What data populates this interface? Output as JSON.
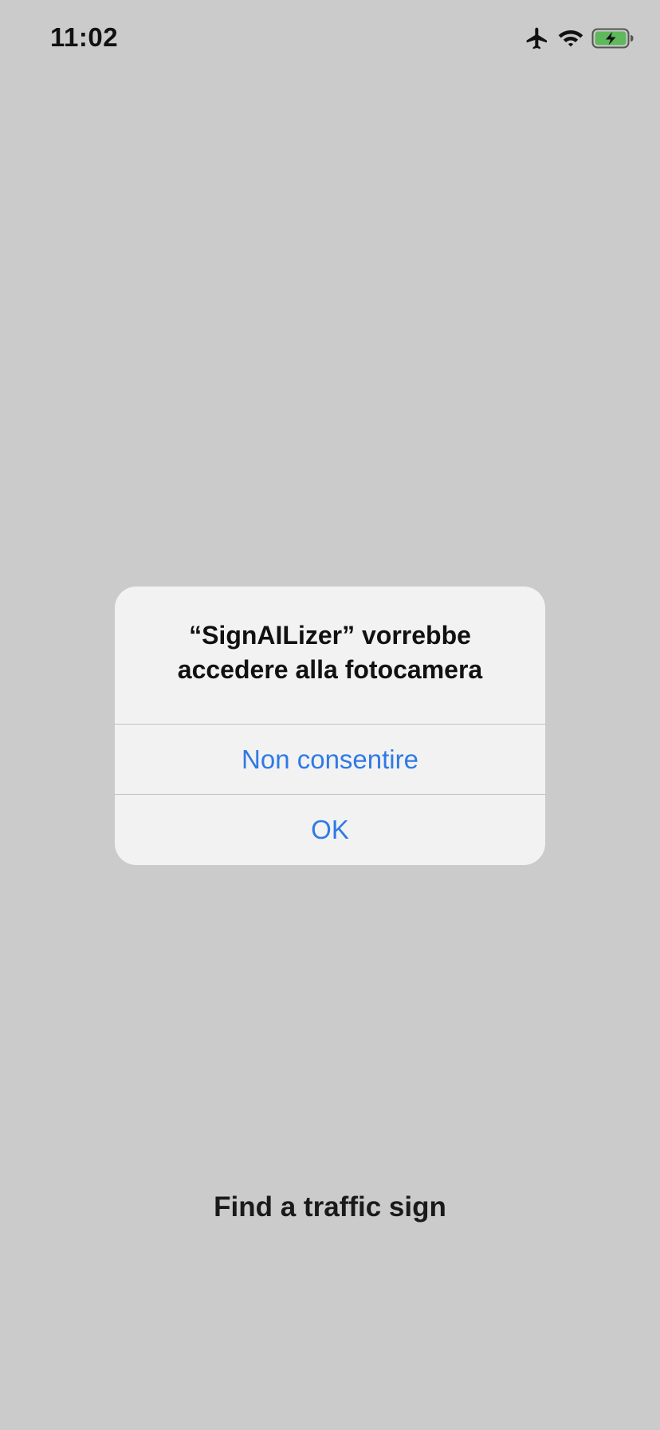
{
  "status_bar": {
    "time": "11:02",
    "icons": [
      "airplane-mode-icon",
      "wifi-icon",
      "battery-charging-icon"
    ],
    "battery_color": "#5fb85b"
  },
  "app": {
    "prompt": "Find a traffic sign",
    "background_color": "#cbcbcb"
  },
  "alert": {
    "title": "“SignAILizer” vorrebbe accedere alla fotocamera",
    "buttons": {
      "deny_label": "Non consentire",
      "ok_label": "OK"
    },
    "button_color": "#2f7ae6"
  }
}
